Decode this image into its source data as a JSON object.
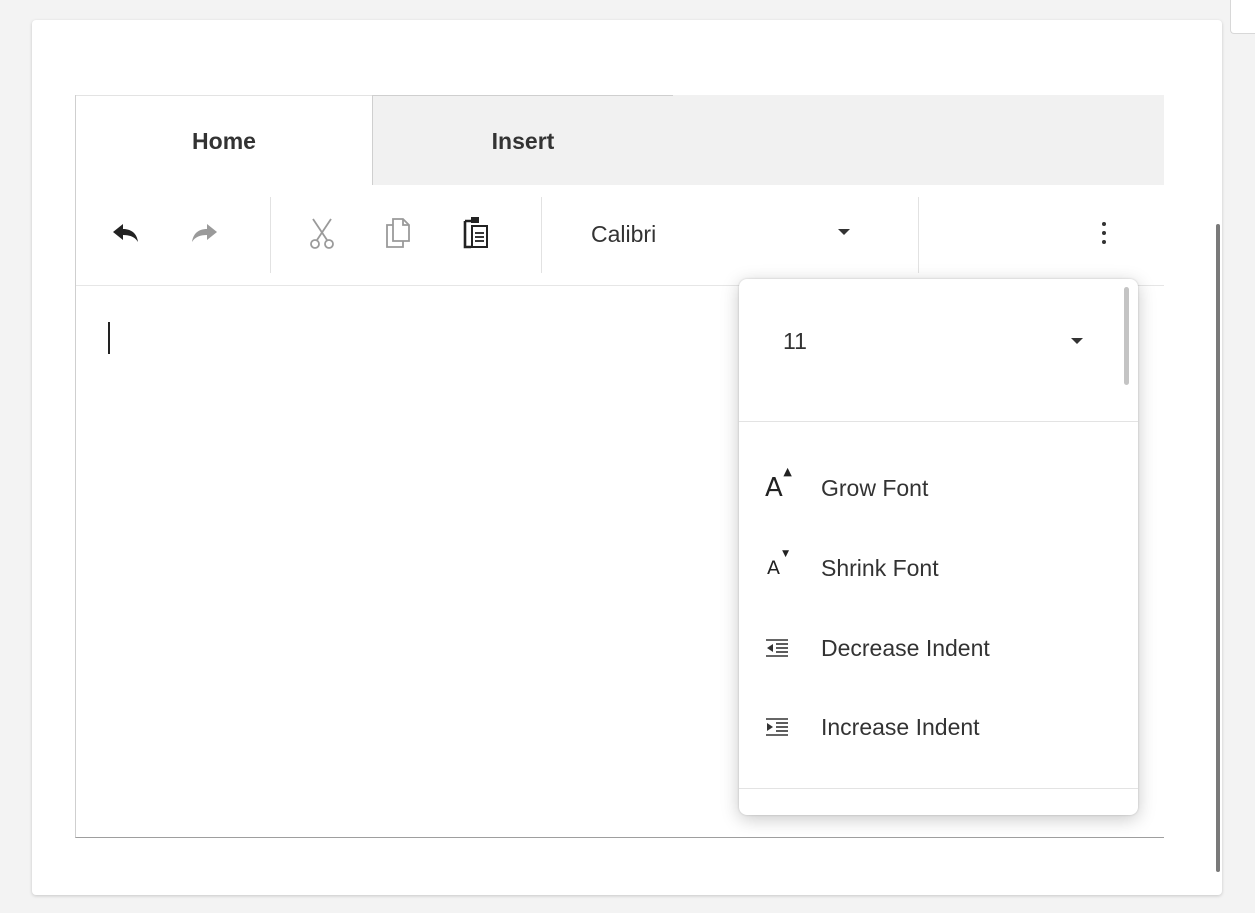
{
  "tabs": [
    {
      "label": "Home",
      "active": true
    },
    {
      "label": "Insert",
      "active": false
    }
  ],
  "toolbar": {
    "buttons": [
      "undo-icon",
      "redo-icon",
      "cut-icon",
      "copy-icon",
      "paste-icon"
    ],
    "font_family": "Calibri",
    "more_icon": "more-vertical-icon"
  },
  "overflow_menu": {
    "font_size": "11",
    "items": [
      {
        "label": "Grow Font",
        "icon": "grow-font-icon"
      },
      {
        "label": "Shrink Font",
        "icon": "shrink-font-icon"
      },
      {
        "label": "Decrease Indent",
        "icon": "decrease-indent-icon"
      },
      {
        "label": "Increase Indent",
        "icon": "increase-indent-icon"
      }
    ]
  },
  "colors": {
    "tab_bar": "#f1f1f1",
    "icon_active": "#222222",
    "icon_disabled": "#9a9a9a"
  }
}
